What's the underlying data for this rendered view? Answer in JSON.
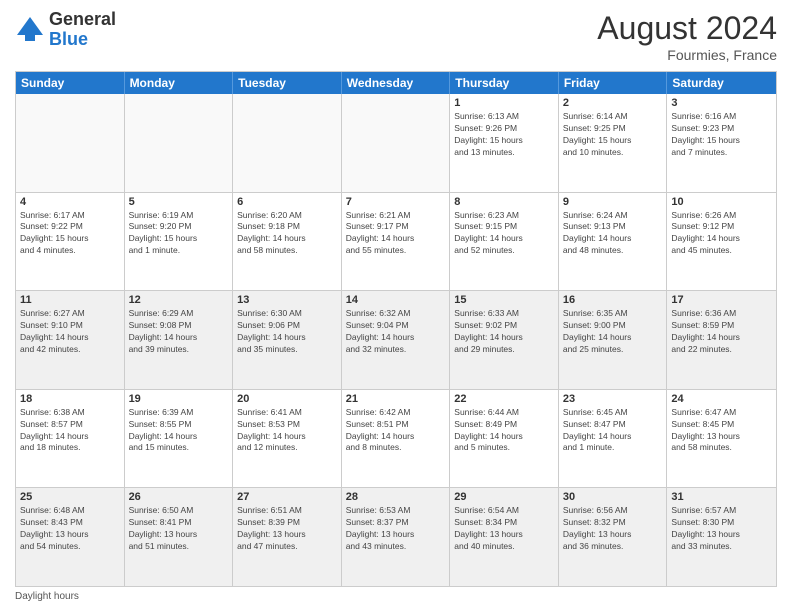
{
  "logo": {
    "general": "General",
    "blue": "Blue"
  },
  "title": "August 2024",
  "subtitle": "Fourmies, France",
  "header": {
    "days": [
      "Sunday",
      "Monday",
      "Tuesday",
      "Wednesday",
      "Thursday",
      "Friday",
      "Saturday"
    ]
  },
  "footer": {
    "note": "Daylight hours"
  },
  "weeks": [
    [
      {
        "day": "",
        "info": "",
        "empty": true
      },
      {
        "day": "",
        "info": "",
        "empty": true
      },
      {
        "day": "",
        "info": "",
        "empty": true
      },
      {
        "day": "",
        "info": "",
        "empty": true
      },
      {
        "day": "1",
        "info": "Sunrise: 6:13 AM\nSunset: 9:26 PM\nDaylight: 15 hours\nand 13 minutes."
      },
      {
        "day": "2",
        "info": "Sunrise: 6:14 AM\nSunset: 9:25 PM\nDaylight: 15 hours\nand 10 minutes."
      },
      {
        "day": "3",
        "info": "Sunrise: 6:16 AM\nSunset: 9:23 PM\nDaylight: 15 hours\nand 7 minutes."
      }
    ],
    [
      {
        "day": "4",
        "info": "Sunrise: 6:17 AM\nSunset: 9:22 PM\nDaylight: 15 hours\nand 4 minutes."
      },
      {
        "day": "5",
        "info": "Sunrise: 6:19 AM\nSunset: 9:20 PM\nDaylight: 15 hours\nand 1 minute."
      },
      {
        "day": "6",
        "info": "Sunrise: 6:20 AM\nSunset: 9:18 PM\nDaylight: 14 hours\nand 58 minutes."
      },
      {
        "day": "7",
        "info": "Sunrise: 6:21 AM\nSunset: 9:17 PM\nDaylight: 14 hours\nand 55 minutes."
      },
      {
        "day": "8",
        "info": "Sunrise: 6:23 AM\nSunset: 9:15 PM\nDaylight: 14 hours\nand 52 minutes."
      },
      {
        "day": "9",
        "info": "Sunrise: 6:24 AM\nSunset: 9:13 PM\nDaylight: 14 hours\nand 48 minutes."
      },
      {
        "day": "10",
        "info": "Sunrise: 6:26 AM\nSunset: 9:12 PM\nDaylight: 14 hours\nand 45 minutes."
      }
    ],
    [
      {
        "day": "11",
        "info": "Sunrise: 6:27 AM\nSunset: 9:10 PM\nDaylight: 14 hours\nand 42 minutes.",
        "shaded": true
      },
      {
        "day": "12",
        "info": "Sunrise: 6:29 AM\nSunset: 9:08 PM\nDaylight: 14 hours\nand 39 minutes.",
        "shaded": true
      },
      {
        "day": "13",
        "info": "Sunrise: 6:30 AM\nSunset: 9:06 PM\nDaylight: 14 hours\nand 35 minutes.",
        "shaded": true
      },
      {
        "day": "14",
        "info": "Sunrise: 6:32 AM\nSunset: 9:04 PM\nDaylight: 14 hours\nand 32 minutes.",
        "shaded": true
      },
      {
        "day": "15",
        "info": "Sunrise: 6:33 AM\nSunset: 9:02 PM\nDaylight: 14 hours\nand 29 minutes.",
        "shaded": true
      },
      {
        "day": "16",
        "info": "Sunrise: 6:35 AM\nSunset: 9:00 PM\nDaylight: 14 hours\nand 25 minutes.",
        "shaded": true
      },
      {
        "day": "17",
        "info": "Sunrise: 6:36 AM\nSunset: 8:59 PM\nDaylight: 14 hours\nand 22 minutes.",
        "shaded": true
      }
    ],
    [
      {
        "day": "18",
        "info": "Sunrise: 6:38 AM\nSunset: 8:57 PM\nDaylight: 14 hours\nand 18 minutes."
      },
      {
        "day": "19",
        "info": "Sunrise: 6:39 AM\nSunset: 8:55 PM\nDaylight: 14 hours\nand 15 minutes."
      },
      {
        "day": "20",
        "info": "Sunrise: 6:41 AM\nSunset: 8:53 PM\nDaylight: 14 hours\nand 12 minutes."
      },
      {
        "day": "21",
        "info": "Sunrise: 6:42 AM\nSunset: 8:51 PM\nDaylight: 14 hours\nand 8 minutes."
      },
      {
        "day": "22",
        "info": "Sunrise: 6:44 AM\nSunset: 8:49 PM\nDaylight: 14 hours\nand 5 minutes."
      },
      {
        "day": "23",
        "info": "Sunrise: 6:45 AM\nSunset: 8:47 PM\nDaylight: 14 hours\nand 1 minute."
      },
      {
        "day": "24",
        "info": "Sunrise: 6:47 AM\nSunset: 8:45 PM\nDaylight: 13 hours\nand 58 minutes."
      }
    ],
    [
      {
        "day": "25",
        "info": "Sunrise: 6:48 AM\nSunset: 8:43 PM\nDaylight: 13 hours\nand 54 minutes.",
        "shaded": true
      },
      {
        "day": "26",
        "info": "Sunrise: 6:50 AM\nSunset: 8:41 PM\nDaylight: 13 hours\nand 51 minutes.",
        "shaded": true
      },
      {
        "day": "27",
        "info": "Sunrise: 6:51 AM\nSunset: 8:39 PM\nDaylight: 13 hours\nand 47 minutes.",
        "shaded": true
      },
      {
        "day": "28",
        "info": "Sunrise: 6:53 AM\nSunset: 8:37 PM\nDaylight: 13 hours\nand 43 minutes.",
        "shaded": true
      },
      {
        "day": "29",
        "info": "Sunrise: 6:54 AM\nSunset: 8:34 PM\nDaylight: 13 hours\nand 40 minutes.",
        "shaded": true
      },
      {
        "day": "30",
        "info": "Sunrise: 6:56 AM\nSunset: 8:32 PM\nDaylight: 13 hours\nand 36 minutes.",
        "shaded": true
      },
      {
        "day": "31",
        "info": "Sunrise: 6:57 AM\nSunset: 8:30 PM\nDaylight: 13 hours\nand 33 minutes.",
        "shaded": true
      }
    ]
  ]
}
